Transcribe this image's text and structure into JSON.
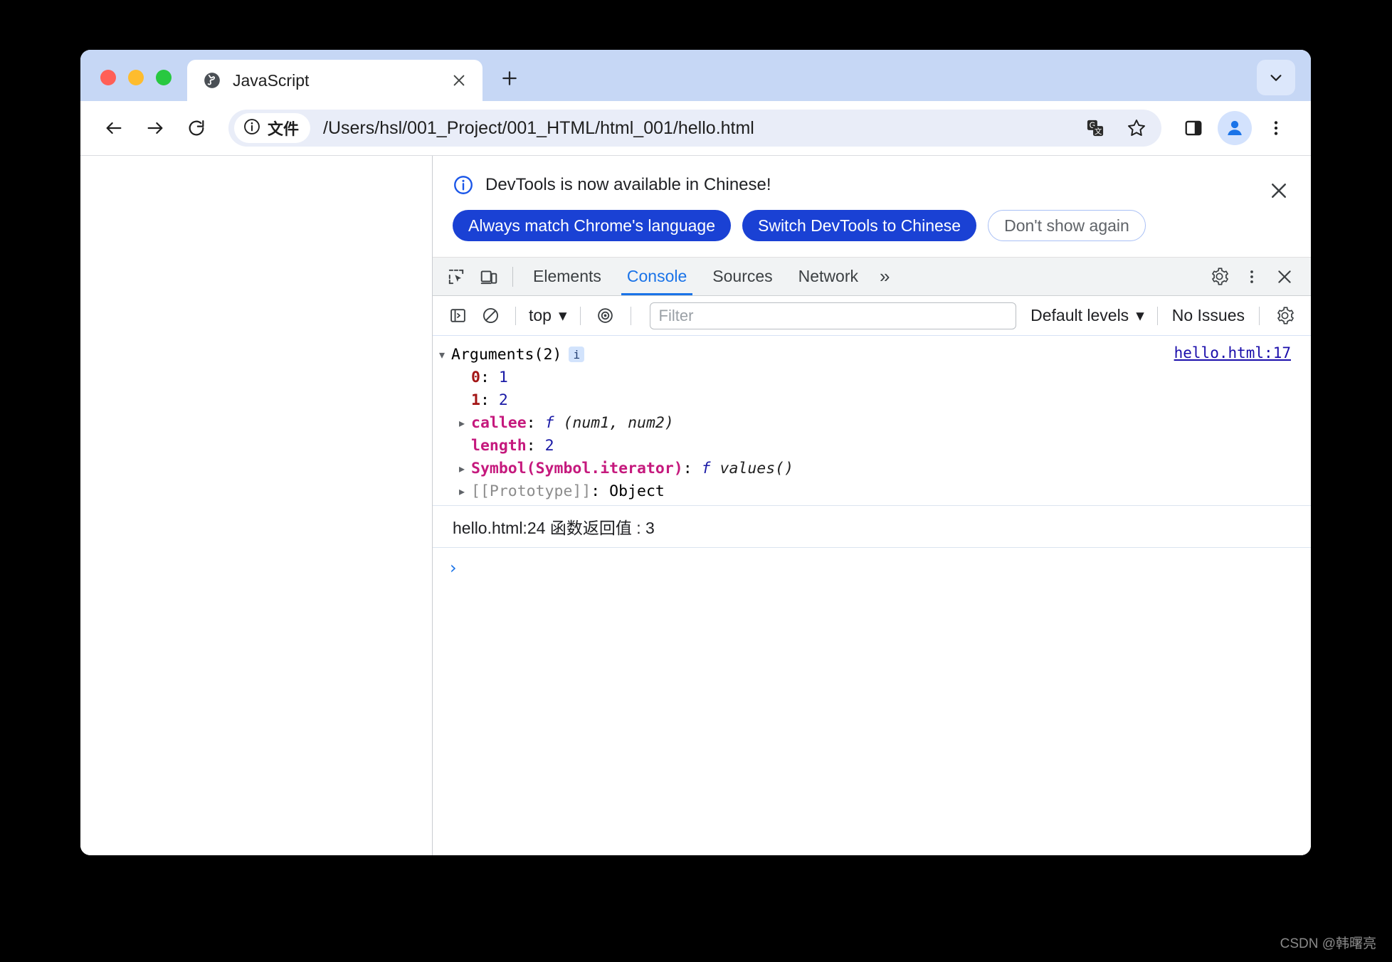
{
  "browser": {
    "tab": {
      "title": "JavaScript",
      "favicon_icon": "globe-icon",
      "close_icon": "close-icon"
    },
    "newtab_icon": "plus-icon",
    "tabsearch_icon": "chevron-down-icon",
    "nav": {
      "back_icon": "arrow-left-icon",
      "forward_icon": "arrow-right-icon",
      "reload_icon": "reload-icon"
    },
    "omnibox": {
      "security_icon": "info-circle-icon",
      "scheme_label": "文件",
      "url": "/Users/hsl/001_Project/001_HTML/html_001/hello.html",
      "translate_icon": "translate-icon",
      "bookmark_icon": "star-icon"
    },
    "actions": {
      "side_panel_icon": "side-panel-icon",
      "profile_icon": "person-icon",
      "menu_icon": "three-dot-menu-icon"
    }
  },
  "devtools": {
    "banner": {
      "info_icon": "info-circle-icon",
      "message": "DevTools is now available in Chinese!",
      "primary_button": "Always match Chrome's language",
      "secondary_button": "Switch DevTools to Chinese",
      "dismiss_button": "Don't show again",
      "close_icon": "close-icon"
    },
    "tabbar": {
      "inspect_icon": "inspect-element-icon",
      "device_icon": "device-toolbar-icon",
      "tabs": [
        {
          "label": "Elements",
          "active": false
        },
        {
          "label": "Console",
          "active": true
        },
        {
          "label": "Sources",
          "active": false
        },
        {
          "label": "Network",
          "active": false
        }
      ],
      "overflow_label": "»",
      "settings_icon": "gear-icon",
      "more_icon": "three-dot-menu-icon",
      "close_icon": "close-icon"
    },
    "console_toolbar": {
      "sidebar_icon": "show-console-sidebar-icon",
      "clear_icon": "clear-console-icon",
      "context_label": "top",
      "context_caret": "▾",
      "live_expression_icon": "eye-icon",
      "filter_placeholder": "Filter",
      "filter_value": "",
      "levels_label": "Default levels",
      "levels_caret": "▾",
      "issues_label": "No Issues",
      "settings_icon": "gear-icon"
    },
    "console_messages": [
      {
        "type": "object",
        "source": "hello.html:17",
        "header": {
          "arrow": "▾",
          "text": "Arguments(2)",
          "badge": "i"
        },
        "rows": [
          {
            "arrow": "",
            "indent": 2,
            "key": "0",
            "key_kind": "num",
            "sep": ": ",
            "value": "1",
            "value_kind": "num"
          },
          {
            "arrow": "",
            "indent": 2,
            "key": "1",
            "key_kind": "num",
            "sep": ": ",
            "value": "2",
            "value_kind": "num"
          },
          {
            "arrow": "▸",
            "indent": 1,
            "key": "callee",
            "key_kind": "prop",
            "sep": ": ",
            "value": "f",
            "value_kind": "fn",
            "sig": " (num1, num2)"
          },
          {
            "arrow": "",
            "indent": 2,
            "key": "length",
            "key_kind": "prop",
            "sep": ": ",
            "value": "2",
            "value_kind": "num"
          },
          {
            "arrow": "▸",
            "indent": 1,
            "key": "Symbol(Symbol.iterator)",
            "key_kind": "prop",
            "sep": ": ",
            "value": "f",
            "value_kind": "fn",
            "sig": " values()"
          },
          {
            "arrow": "▸",
            "indent": 1,
            "key": "[[Prototype]]",
            "key_kind": "internal",
            "sep": ": ",
            "value": "Object",
            "value_kind": "plain"
          }
        ]
      },
      {
        "type": "text",
        "source": "hello.html:24",
        "text": "函数返回值 : 3"
      }
    ],
    "prompt_caret": "›"
  },
  "watermark": "CSDN @韩曙亮"
}
